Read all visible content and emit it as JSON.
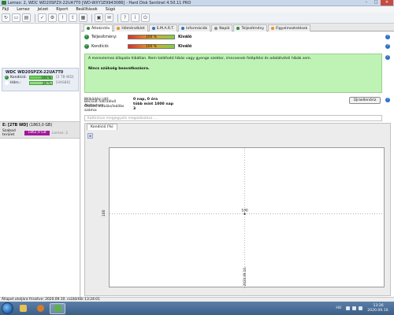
{
  "window": {
    "title": "Lemez: 2, WDC WD20SPZX-22UA7T0 [WD-WXY1E9943086] - Hard Disk Sentinel 4.50.11 PRO"
  },
  "menu": [
    "Fájl",
    "Lemez",
    "Jelzet",
    "Riport",
    "Beállítások",
    "Súgó"
  ],
  "sidebar": {
    "disk_name": "WDC WD20SPZX-22UA7T0",
    "health_label": "Kondíció:",
    "health_value": "100 %",
    "health_extra": "[2 TB WD]",
    "temp_label": "Hőm.:",
    "temp_value": "29 °C",
    "temp_extra": "[HAS80]",
    "volume_name": "E: [2TB WD]",
    "volume_size": "(1863,0 GB)",
    "free_label": "Szabad terület",
    "free_value": "1862,9 GB",
    "free_extra": "Lemez: 2"
  },
  "tabs": [
    {
      "label": "Áttekintés",
      "icon": "green"
    },
    {
      "label": "Hőmérséklet",
      "icon": "orange"
    },
    {
      "label": "S.M.A.R.T.",
      "icon": "blue"
    },
    {
      "label": "Információk",
      "icon": "blue"
    },
    {
      "label": "Napló",
      "icon": "gray"
    },
    {
      "label": "Teljesítmény",
      "icon": "green"
    },
    {
      "label": "Figyelmeztetések",
      "icon": "orange"
    }
  ],
  "status": {
    "performance_label": "Teljesítmény:",
    "performance_value": "100 %",
    "performance_word": "Kiváló",
    "health_label": "Kondíció:",
    "health_value": "100 %",
    "health_word": "Kiváló"
  },
  "message": {
    "text": "A merevlemez állapota hibátlan. Nem található hibás vagy gyenge szektor, imncsenek felépítési és adatátviteli hibák sem.",
    "action": "Nincs szükség beavatkozásra."
  },
  "info": {
    "uptime_label": "Működési idő:",
    "uptime_value": "0 nap, 0 óra",
    "remaining_label": "Becsült hátralévő élettartam:",
    "remaining_value": "több mint 1000 nap",
    "startstop_label": "Összes indulás/leállás száma:",
    "startstop_value": "3",
    "refresh_button": "Újraellenőriz"
  },
  "comment": {
    "placeholder": "Kattintson megjegyzés megadásához ..."
  },
  "graph": {
    "tab_label": "Kondíció (%)",
    "y_label": "100",
    "point_label": "100",
    "x_label": "2020.09.10."
  },
  "chart_data": {
    "type": "line",
    "x": [
      "2020.09.10."
    ],
    "series": [
      {
        "values": [
          100
        ]
      }
    ],
    "ylabel": "",
    "xlabel": ""
  },
  "statusbar": {
    "text": "Állapot utoljára frissítve: 2020.09.10. csütörtök 13:24:01"
  },
  "taskbar": {
    "lang": "HU",
    "time": "13:26",
    "date": "2020.09.10."
  }
}
